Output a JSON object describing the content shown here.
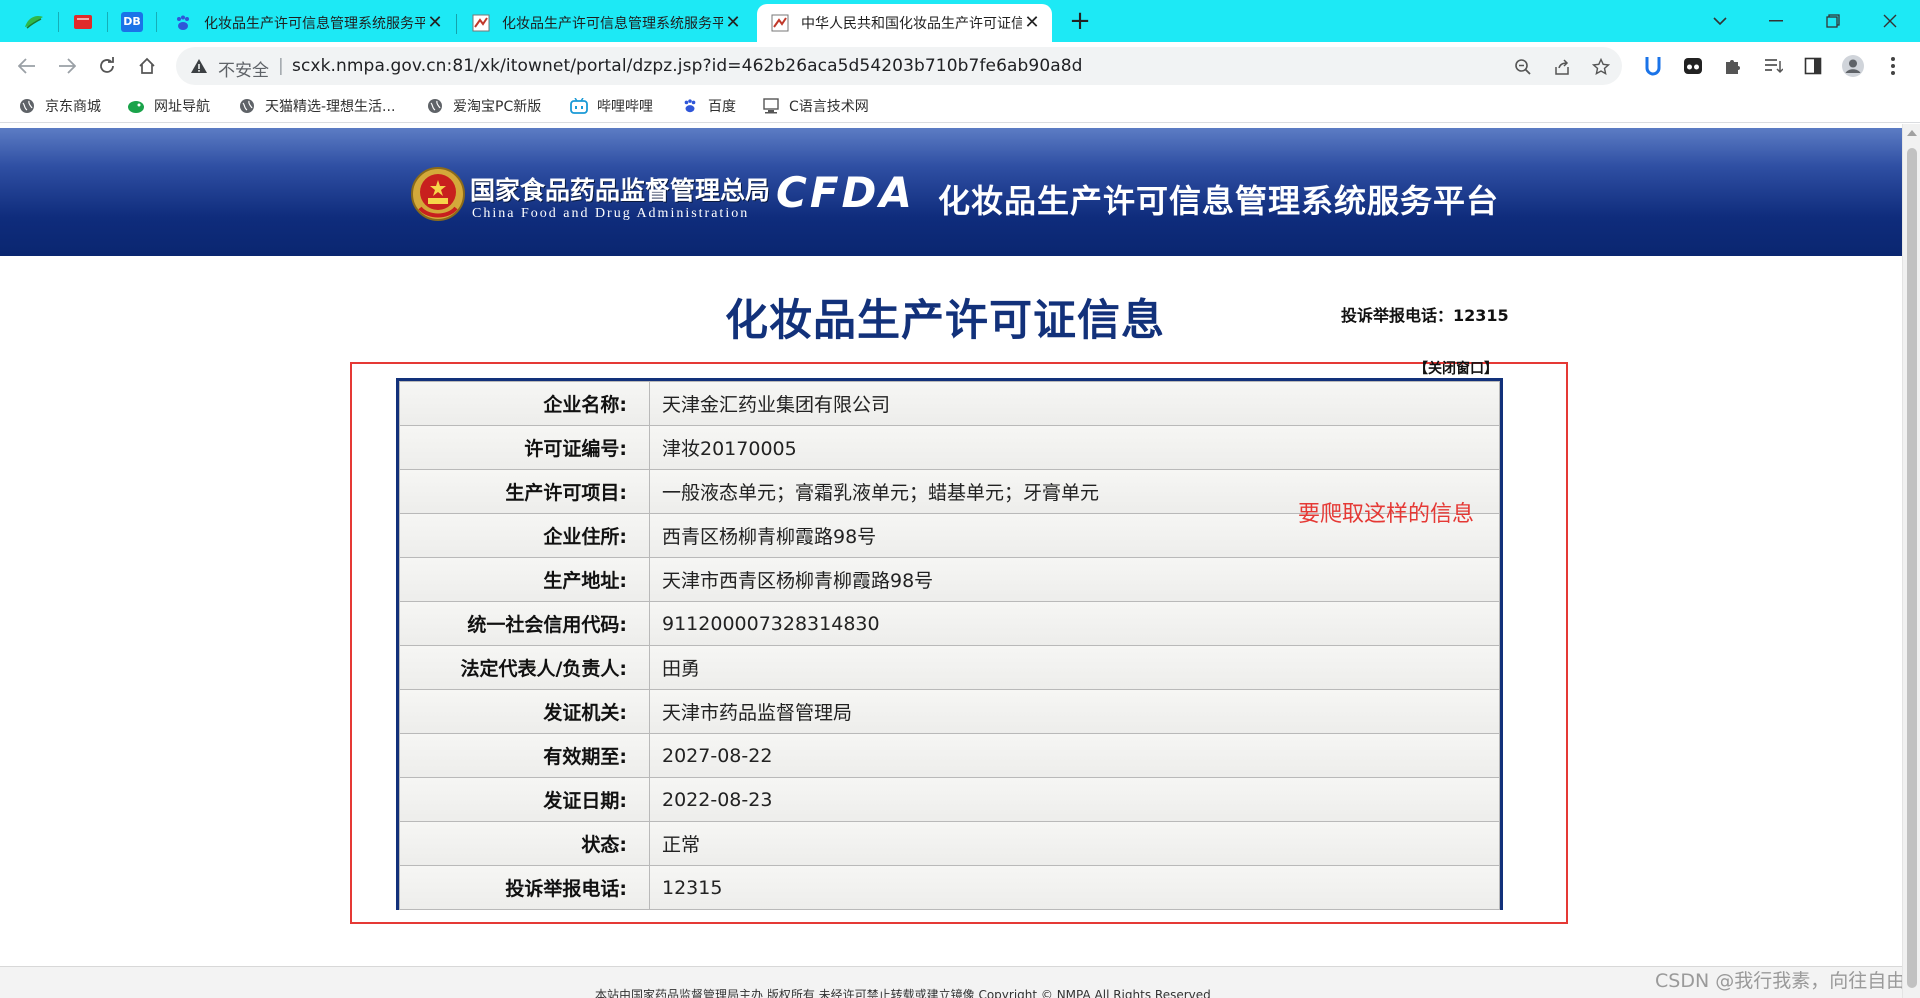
{
  "browser": {
    "tabs": [
      {
        "title": "化妆品生产许可信息管理系统服务平台"
      },
      {
        "title": "化妆品生产许可信息管理系统服务平台"
      },
      {
        "title": "中华人民共和国化妆品生产许可证信息"
      }
    ],
    "pinned_tab_icons": [
      "leaf-icon",
      "red-book-icon",
      "db-icon"
    ],
    "pinned_db_text": "DB",
    "new_tab_label": "+",
    "omnibox": {
      "security_label": "不安全",
      "separator": "|",
      "url": "scxk.nmpa.gov.cn:81/xk/itownet/portal/dzpz.jsp?id=462b26aca5d54203b710b7fe6ab90a8d"
    },
    "bookmarks": [
      {
        "label": "京东商城",
        "icon": "globe-icon"
      },
      {
        "label": "网址导航",
        "icon": "bird-icon"
      },
      {
        "label": "天猫精选-理想生活...",
        "icon": "globe-icon"
      },
      {
        "label": "爱淘宝PC新版",
        "icon": "globe-icon"
      },
      {
        "label": "哔哩哔哩",
        "icon": "bilibili-icon"
      },
      {
        "label": "百度",
        "icon": "paw-icon"
      },
      {
        "label": "C语言技术网",
        "icon": "computer-icon"
      }
    ],
    "colors": {
      "tabbar": "#1de9f5",
      "accent_blue": "#12317a",
      "annotation_red": "#e53935"
    }
  },
  "banner": {
    "agency_cn": "国家食品药品监督管理总局",
    "agency_en": "China Food and Drug Administration",
    "logo": "CFDA",
    "platform_title": "化妆品生产许可信息管理系统服务平台"
  },
  "page": {
    "title": "化妆品生产许可证信息",
    "hotline": "投诉举报电话：12315",
    "close_window": "【关闭窗口】",
    "annotation": "要爬取这样的信息",
    "footer": "本站由国家药品监督管理局主办 版权所有 未经许可禁止转载或建立镜像 Copyright © NMPA All Rights Reserved",
    "watermark": "CSDN @我行我素，向往自由"
  },
  "license": {
    "rows": [
      {
        "label": "企业名称:",
        "value": "天津金汇药业集团有限公司"
      },
      {
        "label": "许可证编号:",
        "value": "津妆20170005"
      },
      {
        "label": "生产许可项目:",
        "value": "一般液态单元；膏霜乳液单元；蜡基单元；牙膏单元"
      },
      {
        "label": "企业住所:",
        "value": "西青区杨柳青柳霞路98号"
      },
      {
        "label": "生产地址:",
        "value": "天津市西青区杨柳青柳霞路98号"
      },
      {
        "label": "统一社会信用代码:",
        "value": "911200007328314830"
      },
      {
        "label": "法定代表人/负责人:",
        "value": "田勇"
      },
      {
        "label": "发证机关:",
        "value": "天津市药品监督管理局"
      },
      {
        "label": "有效期至:",
        "value": "2027-08-22"
      },
      {
        "label": "发证日期:",
        "value": "2022-08-23"
      },
      {
        "label": "状态:",
        "value": "正常"
      },
      {
        "label": "投诉举报电话:",
        "value": "12315"
      }
    ]
  }
}
